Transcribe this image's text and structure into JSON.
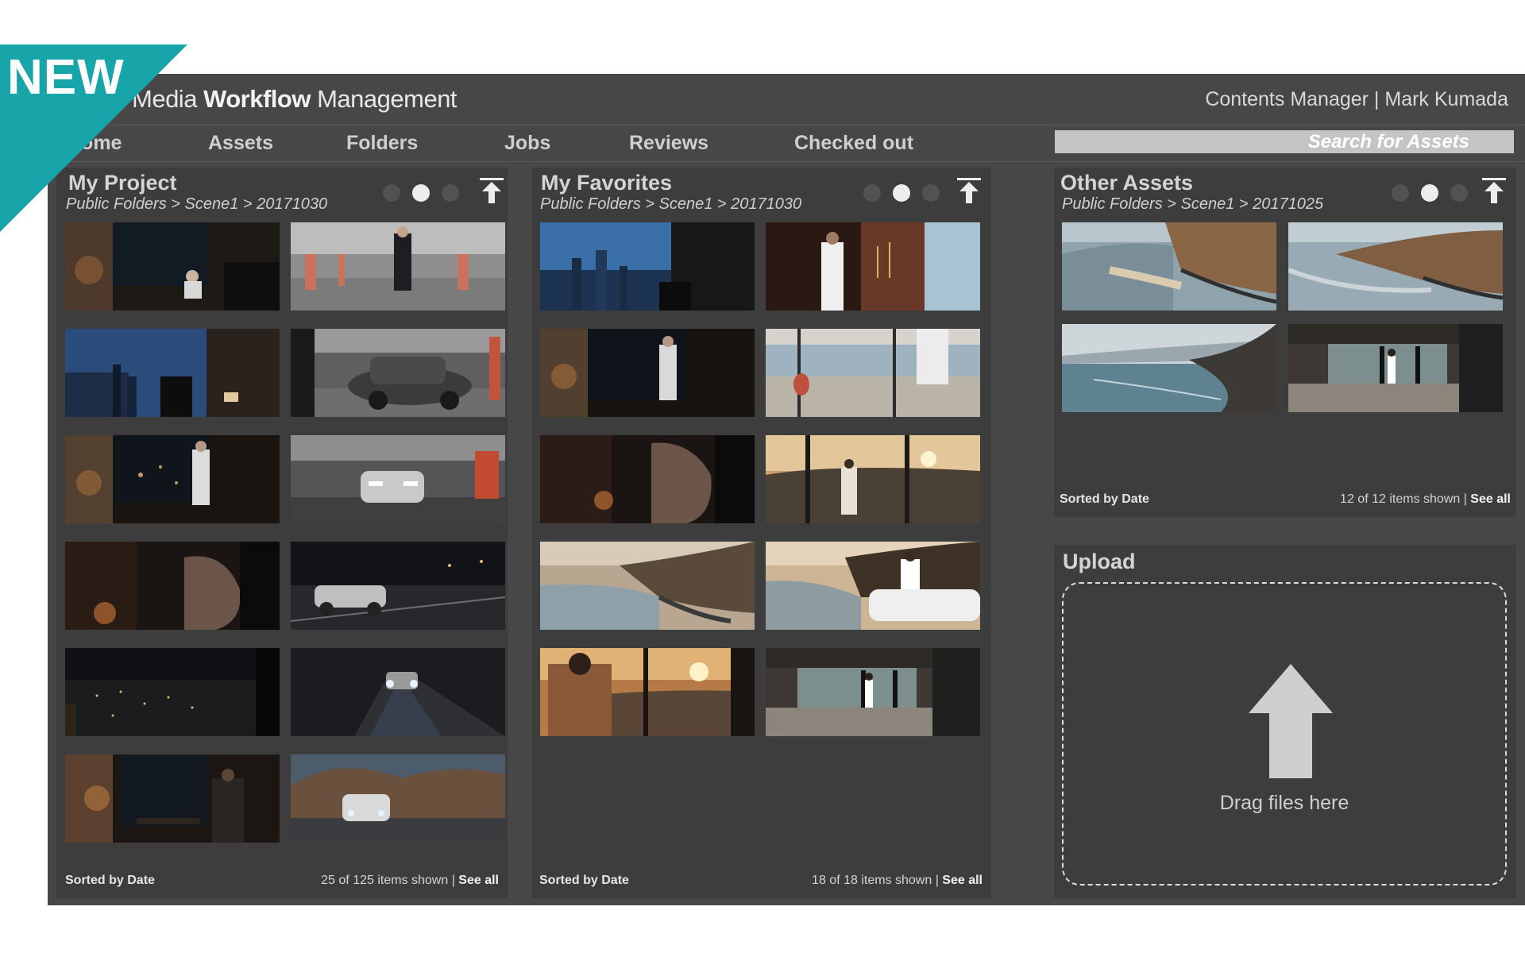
{
  "badge": {
    "label": "NEW",
    "color": "#18a5a9"
  },
  "app": {
    "title_light_1": "Media ",
    "title_bold": "Workflow",
    "title_light_2": " Management",
    "user": "Contents Manager | Mark Kumada"
  },
  "nav": {
    "items": [
      "Home",
      "Assets",
      "Folders",
      "Jobs",
      "Reviews",
      "Checked out"
    ],
    "search_placeholder": "Search for Assets"
  },
  "panels": {
    "my_project": {
      "title": "My Project",
      "breadcrumb": "Public Folders >  Scene1 >  20171030",
      "sorted": "Sorted by Date",
      "count": "25 of 125 items shown | ",
      "see_all": "See all",
      "thumbnails": [
        "Man working at laptop in dark office",
        "Man in suit in parking garage",
        "City skyline at dusk from office window",
        "Silver BMW parked in garage",
        "Man standing by office window at night",
        "BMW with headlights on in garage",
        "Close-up of man's face at night",
        "Silver car driving on night road",
        "Night city lights aerial view",
        "Car headlights on dark road",
        "Man in dim office at night",
        "BMW on mountain road"
      ]
    },
    "my_favorites": {
      "title": "My Favorites",
      "breadcrumb": "Public Folders >  Scene1 >  20171030",
      "sorted": "Sorted by Date",
      "count": "18 of 18 items shown | ",
      "see_all": "See all",
      "thumbnails": [
        "City skyline through office window",
        "Man in white shirt by candelabra",
        "Man in dark office at night",
        "Man with decanter by ocean view",
        "Close-up of man's face",
        "Man overlooking sunset coast",
        "Coastal road and cliffs",
        "Man leaning on car at coast",
        "Man by window at sunset",
        "Man walking through glass house"
      ]
    },
    "other_assets": {
      "title": "Other Assets",
      "breadcrumb": "Public Folders >  Scene1 >  20171025",
      "sorted": "Sorted by Date",
      "count": "12 of 12 items shown | ",
      "see_all": "See all",
      "thumbnails": [
        "Coastal road aerial view",
        "Coastal road aerial view, wide",
        "Ocean coastline cliffs",
        "Man walking into glass house"
      ]
    },
    "upload": {
      "title": "Upload",
      "drop_text": "Drag files here"
    }
  }
}
